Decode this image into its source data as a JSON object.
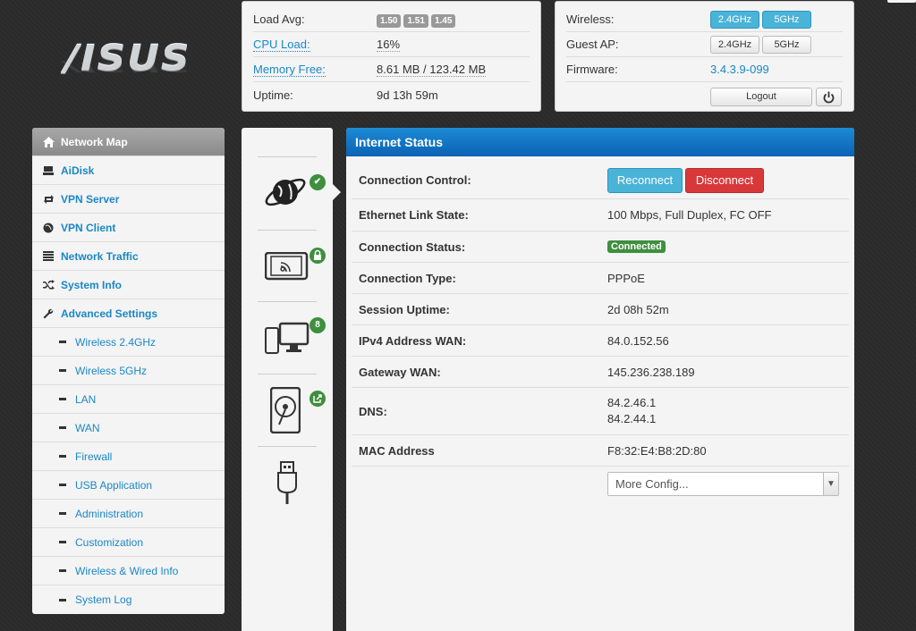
{
  "brand": {
    "logo": "/ISUS"
  },
  "system_info": {
    "load_avg": {
      "label": "Load Avg:",
      "values": [
        "1.50",
        "1.51",
        "1.45"
      ]
    },
    "cpu_load": {
      "label": "CPU Load:",
      "value": "16%"
    },
    "memory_free": {
      "label": "Memory Free:",
      "value": "8.61 MB / 123.42 MB"
    },
    "uptime": {
      "label": "Uptime:",
      "value": "9d 13h 59m"
    }
  },
  "controls": {
    "wireless": {
      "label": "Wireless:",
      "btn_24": "2.4GHz",
      "btn_5": "5GHz"
    },
    "guest_ap": {
      "label": "Guest AP:",
      "btn_24": "2.4GHz",
      "btn_5": "5GHz"
    },
    "firmware": {
      "label": "Firmware:",
      "value": "3.4.3.9-099"
    },
    "logout_label": "Logout",
    "power_icon": "power-icon"
  },
  "sidebar": {
    "items": [
      {
        "label": "Network Map",
        "icon": "home-icon",
        "active": true
      },
      {
        "label": "AiDisk",
        "icon": "hdd-icon"
      },
      {
        "label": "VPN Server",
        "icon": "retweet-icon"
      },
      {
        "label": "VPN Client",
        "icon": "globe-icon"
      },
      {
        "label": "Network Traffic",
        "icon": "list-icon"
      },
      {
        "label": "System Info",
        "icon": "random-icon"
      },
      {
        "label": "Advanced Settings",
        "icon": "wrench-icon"
      }
    ],
    "subitems": [
      "Wireless 2.4GHz",
      "Wireless 5GHz",
      "LAN",
      "WAN",
      "Firewall",
      "USB Application",
      "Administration",
      "Customization",
      "Wireless & Wired Info",
      "System Log"
    ]
  },
  "devices": {
    "internet_badge": "✔",
    "clients_badge": "8"
  },
  "internet_status": {
    "title": "Internet Status",
    "connection_control": {
      "label": "Connection Control:",
      "reconnect": "Reconnect",
      "disconnect": "Disconnect"
    },
    "ethernet_link": {
      "label": "Ethernet Link State:",
      "value": "100 Mbps, Full Duplex, FC OFF"
    },
    "connection_status": {
      "label": "Connection Status:",
      "value": "Connected"
    },
    "connection_type": {
      "label": "Connection Type:",
      "value": "PPPoE"
    },
    "session_uptime": {
      "label": "Session Uptime:",
      "value": "2d 08h 52m"
    },
    "ipv4_wan": {
      "label": "IPv4 Address WAN:",
      "value": "84.0.152.56"
    },
    "gateway_wan": {
      "label": "Gateway WAN:",
      "value": "145.236.238.189"
    },
    "dns": {
      "label": "DNS:",
      "values": [
        "84.2.46.1",
        "84.2.44.1"
      ]
    },
    "mac": {
      "label": "MAC Address",
      "value": "F8:32:E4:B8:2D:80"
    },
    "more_config": "More Config..."
  },
  "colors": {
    "accent": "#1a87c6",
    "header_blue": "#0b62b3",
    "success": "#3e8f3e",
    "danger": "#d9383a",
    "info": "#4ab3d8"
  }
}
